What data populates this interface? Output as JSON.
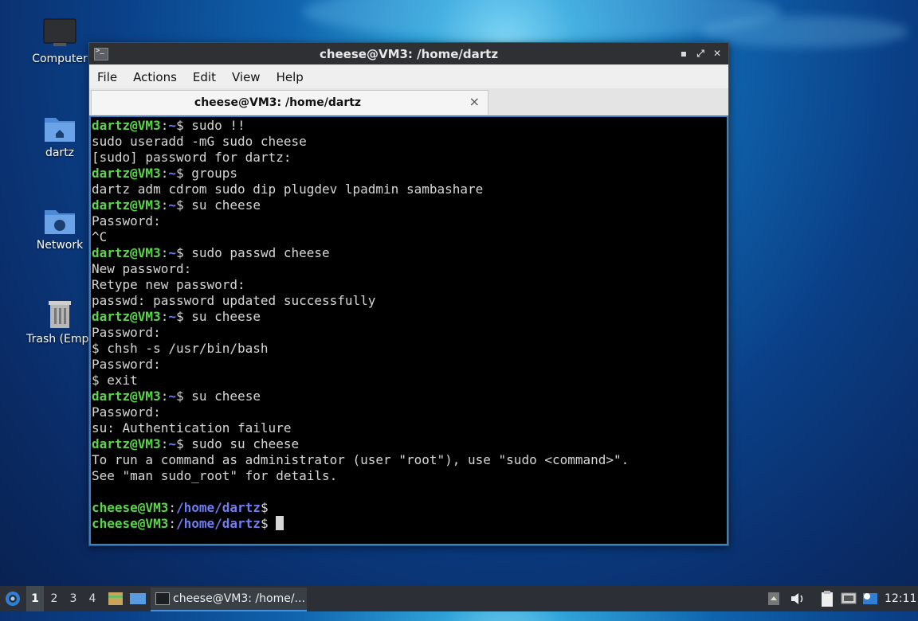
{
  "desktop": {
    "icons": [
      {
        "label": "Computer"
      },
      {
        "label": "dartz"
      },
      {
        "label": "Network"
      },
      {
        "label": "Trash (Empt"
      }
    ]
  },
  "window": {
    "title": "cheese@VM3: /home/dartz",
    "menu": [
      "File",
      "Actions",
      "Edit",
      "View",
      "Help"
    ],
    "tab_label": "cheese@VM3: /home/dartz",
    "tab_close": "×",
    "controls": {
      "minimize": "▪",
      "maximize": "⤢",
      "close": "✕"
    }
  },
  "terminal": {
    "prompt_user": "dartz@VM3",
    "prompt_path": "~",
    "root_user": "cheese@VM3",
    "root_path": "/home/dartz",
    "lines": [
      {
        "type": "prompt",
        "cmd": " sudo !!"
      },
      {
        "type": "out",
        "text": "sudo useradd -mG sudo cheese"
      },
      {
        "type": "out",
        "text": "[sudo] password for dartz:"
      },
      {
        "type": "prompt",
        "cmd": " groups"
      },
      {
        "type": "out",
        "text": "dartz adm cdrom sudo dip plugdev lpadmin sambashare"
      },
      {
        "type": "prompt",
        "cmd": " su cheese"
      },
      {
        "type": "out",
        "text": "Password:"
      },
      {
        "type": "out",
        "text": "^C"
      },
      {
        "type": "prompt",
        "cmd": " sudo passwd cheese"
      },
      {
        "type": "out",
        "text": "New password:"
      },
      {
        "type": "out",
        "text": "Retype new password:"
      },
      {
        "type": "out",
        "text": "passwd: password updated successfully"
      },
      {
        "type": "prompt",
        "cmd": " su cheese"
      },
      {
        "type": "out",
        "text": "Password:"
      },
      {
        "type": "out",
        "text": "$ chsh -s /usr/bin/bash"
      },
      {
        "type": "out",
        "text": "Password:"
      },
      {
        "type": "out",
        "text": "$ exit"
      },
      {
        "type": "prompt",
        "cmd": " su cheese"
      },
      {
        "type": "out",
        "text": "Password:"
      },
      {
        "type": "out",
        "text": "su: Authentication failure"
      },
      {
        "type": "prompt",
        "cmd": " sudo su cheese"
      },
      {
        "type": "out",
        "text": "To run a command as administrator (user \"root\"), use \"sudo <command>\"."
      },
      {
        "type": "out",
        "text": "See \"man sudo_root\" for details."
      },
      {
        "type": "out",
        "text": ""
      },
      {
        "type": "root",
        "cmd": ""
      },
      {
        "type": "root",
        "cmd": " ",
        "cursor": true
      }
    ]
  },
  "taskbar": {
    "workspaces": [
      "1",
      "2",
      "3",
      "4"
    ],
    "active_workspace": "1",
    "task_label": "cheese@VM3: /home/...",
    "clock": "12:11"
  }
}
